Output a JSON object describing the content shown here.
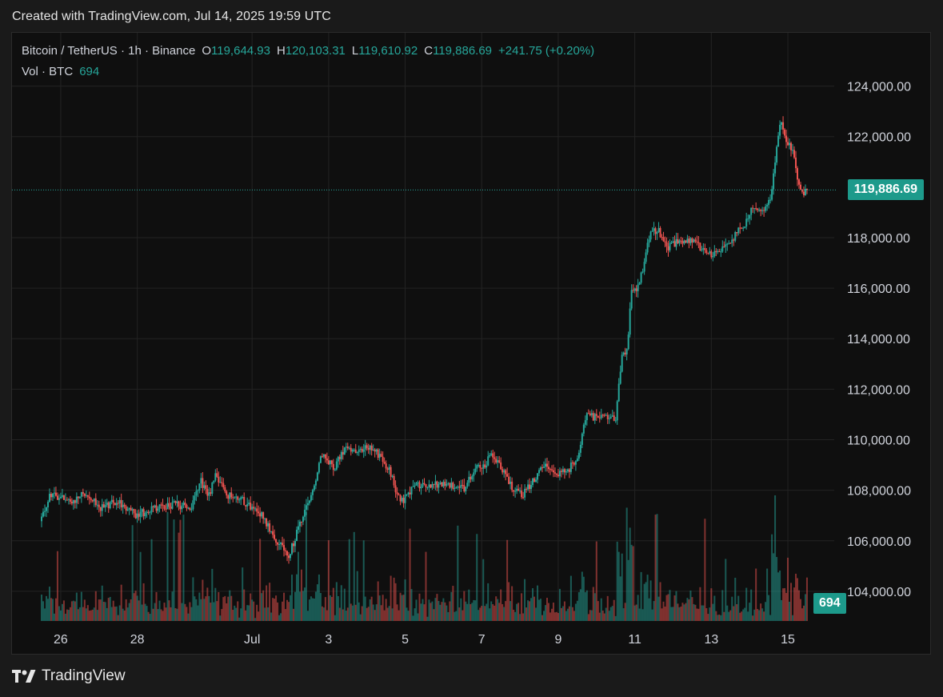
{
  "caption": "Created with TradingView.com, Jul 14, 2025 19:59 UTC",
  "legend": {
    "symbol": "Bitcoin / TetherUS · 1h · Binance",
    "open_key": "O",
    "open": "119,644.93",
    "high_key": "H",
    "high": "120,103.31",
    "low_key": "L",
    "low": "119,610.92",
    "close_key": "C",
    "close": "119,886.69",
    "change": "+241.75 (+0.20%)",
    "vol_label": "Vol · BTC",
    "vol_value": "694"
  },
  "price_badge": "119,886.69",
  "volume_badge": "694",
  "footer_brand": "TradingView",
  "colors": {
    "up": "#26a69a",
    "down": "#ef5350",
    "grid": "#232323",
    "background": "#0f0f0f"
  },
  "chart_data": {
    "type": "candlestick",
    "interval": "1h",
    "exchange": "Binance",
    "y_axis": {
      "ticks": [
        "124,000.00",
        "122,000.00",
        "118,000.00",
        "116,000.00",
        "114,000.00",
        "112,000.00",
        "110,000.00",
        "108,000.00",
        "106,000.00",
        "104,000.00"
      ],
      "tick_values": [
        124000,
        122000,
        118000,
        116000,
        114000,
        112000,
        110000,
        108000,
        106000,
        104000
      ],
      "range": [
        103300,
        125000
      ]
    },
    "x_axis": {
      "labels": [
        "26",
        "28",
        "Jul",
        "3",
        "5",
        "7",
        "9",
        "11",
        "13",
        "15"
      ],
      "label_days": [
        -5,
        -3,
        0,
        2,
        4,
        6,
        8,
        10,
        12,
        14
      ],
      "range_days": [
        -5.5,
        14.25
      ]
    },
    "last_price": 119886.69,
    "volume_max": 2300,
    "anchors": [
      {
        "d": -5.6,
        "p": 106400
      },
      {
        "d": -5.2,
        "p": 107900
      },
      {
        "d": -4.7,
        "p": 107500
      },
      {
        "d": -4.3,
        "p": 107900
      },
      {
        "d": -3.9,
        "p": 107300
      },
      {
        "d": -3.5,
        "p": 107600
      },
      {
        "d": -3.0,
        "p": 107000
      },
      {
        "d": -2.5,
        "p": 107300
      },
      {
        "d": -2.0,
        "p": 107450
      },
      {
        "d": -1.55,
        "p": 107300
      },
      {
        "d": -1.3,
        "p": 108400
      },
      {
        "d": -1.1,
        "p": 107700
      },
      {
        "d": -0.9,
        "p": 108600
      },
      {
        "d": -0.6,
        "p": 107800
      },
      {
        "d": -0.2,
        "p": 107600
      },
      {
        "d": 0.3,
        "p": 107000
      },
      {
        "d": 0.7,
        "p": 106000
      },
      {
        "d": 1.0,
        "p": 105400
      },
      {
        "d": 1.3,
        "p": 106700
      },
      {
        "d": 1.6,
        "p": 107800
      },
      {
        "d": 1.85,
        "p": 109500
      },
      {
        "d": 2.2,
        "p": 108900
      },
      {
        "d": 2.5,
        "p": 109800
      },
      {
        "d": 2.75,
        "p": 109400
      },
      {
        "d": 3.0,
        "p": 109800
      },
      {
        "d": 3.3,
        "p": 109500
      },
      {
        "d": 3.6,
        "p": 108900
      },
      {
        "d": 3.85,
        "p": 107800
      },
      {
        "d": 4.0,
        "p": 107600
      },
      {
        "d": 4.3,
        "p": 108200
      },
      {
        "d": 4.8,
        "p": 108200
      },
      {
        "d": 5.3,
        "p": 108200
      },
      {
        "d": 5.6,
        "p": 108100
      },
      {
        "d": 5.85,
        "p": 108900
      },
      {
        "d": 6.1,
        "p": 109000
      },
      {
        "d": 6.3,
        "p": 109400
      },
      {
        "d": 6.6,
        "p": 108800
      },
      {
        "d": 6.85,
        "p": 108100
      },
      {
        "d": 7.1,
        "p": 107800
      },
      {
        "d": 7.35,
        "p": 108300
      },
      {
        "d": 7.65,
        "p": 109000
      },
      {
        "d": 8.0,
        "p": 108700
      },
      {
        "d": 8.3,
        "p": 108800
      },
      {
        "d": 8.55,
        "p": 109300
      },
      {
        "d": 8.75,
        "p": 110900
      },
      {
        "d": 8.9,
        "p": 110900
      },
      {
        "d": 9.2,
        "p": 111000
      },
      {
        "d": 9.45,
        "p": 110900
      },
      {
        "d": 9.55,
        "p": 110900
      },
      {
        "d": 9.7,
        "p": 113400
      },
      {
        "d": 9.85,
        "p": 113600
      },
      {
        "d": 9.95,
        "p": 116100
      },
      {
        "d": 10.1,
        "p": 115900
      },
      {
        "d": 10.25,
        "p": 116800
      },
      {
        "d": 10.45,
        "p": 118200
      },
      {
        "d": 10.65,
        "p": 118300
      },
      {
        "d": 10.85,
        "p": 117600
      },
      {
        "d": 11.1,
        "p": 117800
      },
      {
        "d": 11.4,
        "p": 117900
      },
      {
        "d": 11.7,
        "p": 117700
      },
      {
        "d": 11.95,
        "p": 117300
      },
      {
        "d": 12.2,
        "p": 117400
      },
      {
        "d": 12.5,
        "p": 117700
      },
      {
        "d": 12.7,
        "p": 118200
      },
      {
        "d": 12.9,
        "p": 118500
      },
      {
        "d": 13.1,
        "p": 119200
      },
      {
        "d": 13.35,
        "p": 119000
      },
      {
        "d": 13.6,
        "p": 119600
      },
      {
        "d": 13.75,
        "p": 121600
      },
      {
        "d": 13.85,
        "p": 122700
      },
      {
        "d": 14.0,
        "p": 121900
      },
      {
        "d": 14.2,
        "p": 121300
      },
      {
        "d": 14.3,
        "p": 120200
      },
      {
        "d": 14.45,
        "p": 119800
      },
      {
        "d": 14.5,
        "p": 119886.69
      }
    ]
  }
}
